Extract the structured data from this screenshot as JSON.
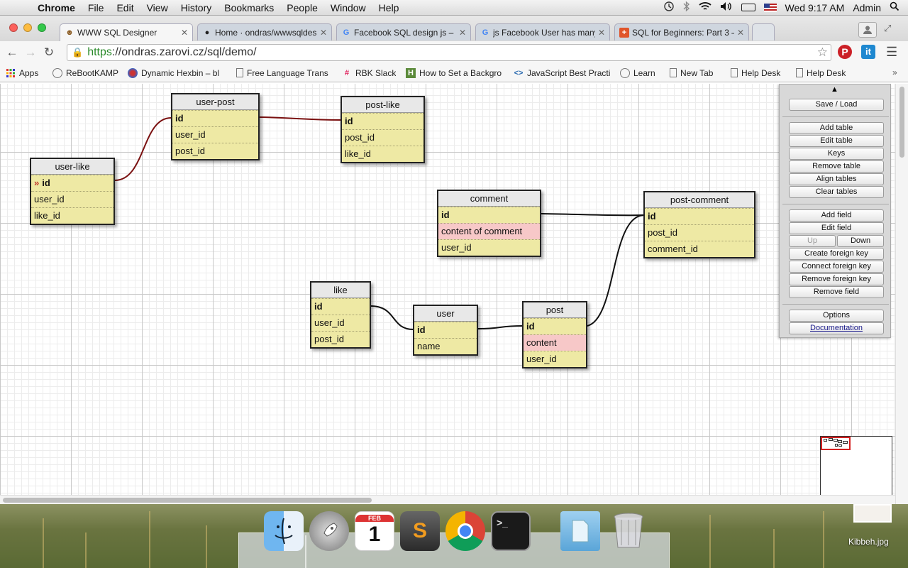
{
  "menubar": {
    "apple_glyph": "",
    "items": [
      "Chrome",
      "File",
      "Edit",
      "View",
      "History",
      "Bookmarks",
      "People",
      "Window",
      "Help"
    ],
    "clock": "Wed 9:17 AM",
    "user": "Admin"
  },
  "tabs": [
    {
      "title": "WWW SQL Designer",
      "icon": "sql-designer-icon",
      "active": true
    },
    {
      "title": "Home · ondras/wwwsqldes",
      "icon": "github-icon",
      "active": false
    },
    {
      "title": "Facebook SQL design js – c",
      "icon": "google-icon",
      "active": false
    },
    {
      "title": "js Facebook User has many",
      "icon": "google-icon",
      "active": false
    },
    {
      "title": "SQL for Beginners: Part 3 –",
      "icon": "tutsplus-icon",
      "active": false
    }
  ],
  "address": {
    "scheme": "https",
    "rest": "://ondras.zarovi.cz/sql/demo/"
  },
  "bookmarks": [
    {
      "label": "Apps",
      "icon": "apps-grid-icon"
    },
    {
      "label": "ReBootKAMP",
      "icon": "rebootkamp-icon"
    },
    {
      "label": "Dynamic Hexbin – bl",
      "icon": "hexbin-icon"
    },
    {
      "label": "Free Language Trans",
      "icon": "page-icon"
    },
    {
      "label": "RBK Slack",
      "icon": "slack-icon"
    },
    {
      "label": "How to Set a Backgro",
      "icon": "h-icon"
    },
    {
      "label": "JavaScript Best Practi",
      "icon": "code-icon"
    },
    {
      "label": "Learn",
      "icon": "learn-icon"
    },
    {
      "label": "New Tab",
      "icon": "page-icon"
    },
    {
      "label": "Help Desk",
      "icon": "page-icon"
    },
    {
      "label": "Help Desk",
      "icon": "page-icon"
    }
  ],
  "tables": {
    "user_post": {
      "name": "user-post",
      "fields": [
        "id",
        "user_id",
        "post_id"
      ]
    },
    "post_like": {
      "name": "post-like",
      "fields": [
        "id",
        "post_id",
        "like_id"
      ]
    },
    "user_like": {
      "name": "user-like",
      "fields": [
        "id",
        "user_id",
        "like_id"
      ]
    },
    "comment": {
      "name": "comment",
      "fields": [
        "id",
        "content of comment",
        "user_id"
      ]
    },
    "post_comment": {
      "name": "post-comment",
      "fields": [
        "id",
        "post_id",
        "comment_id"
      ]
    },
    "like": {
      "name": "like",
      "fields": [
        "id",
        "user_id",
        "post_id"
      ]
    },
    "user": {
      "name": "user",
      "fields": [
        "id",
        "name"
      ]
    },
    "post": {
      "name": "post",
      "fields": [
        "id",
        "content",
        "user_id"
      ]
    }
  },
  "fk_marker": "»",
  "panel": {
    "scroll_glyph": "▲",
    "save_load": "Save / Load",
    "table_buttons": [
      "Add table",
      "Edit table",
      "Keys",
      "Remove table",
      "Align tables",
      "Clear tables"
    ],
    "add_field": "Add field",
    "edit_field": "Edit field",
    "up": "Up",
    "down": "Down",
    "field_buttons": [
      "Create foreign key",
      "Connect foreign key",
      "Remove foreign key",
      "Remove field"
    ],
    "options": "Options",
    "documentation": "Documentation"
  },
  "dock": {
    "apps": [
      "Finder",
      "Launchpad",
      "Calendar",
      "Sublime Text",
      "Google Chrome",
      "Terminal",
      "Documents",
      "Trash"
    ],
    "calendar_month": "FEB",
    "calendar_day": "1"
  },
  "desktop_file": "Kibbeh.jpg",
  "colors": {
    "table_body": "#eee9a4",
    "highlight_row": "#f7c8c8",
    "relation_selected": "#7a1010",
    "relation": "#111111",
    "https_green": "#2a8a2a"
  }
}
